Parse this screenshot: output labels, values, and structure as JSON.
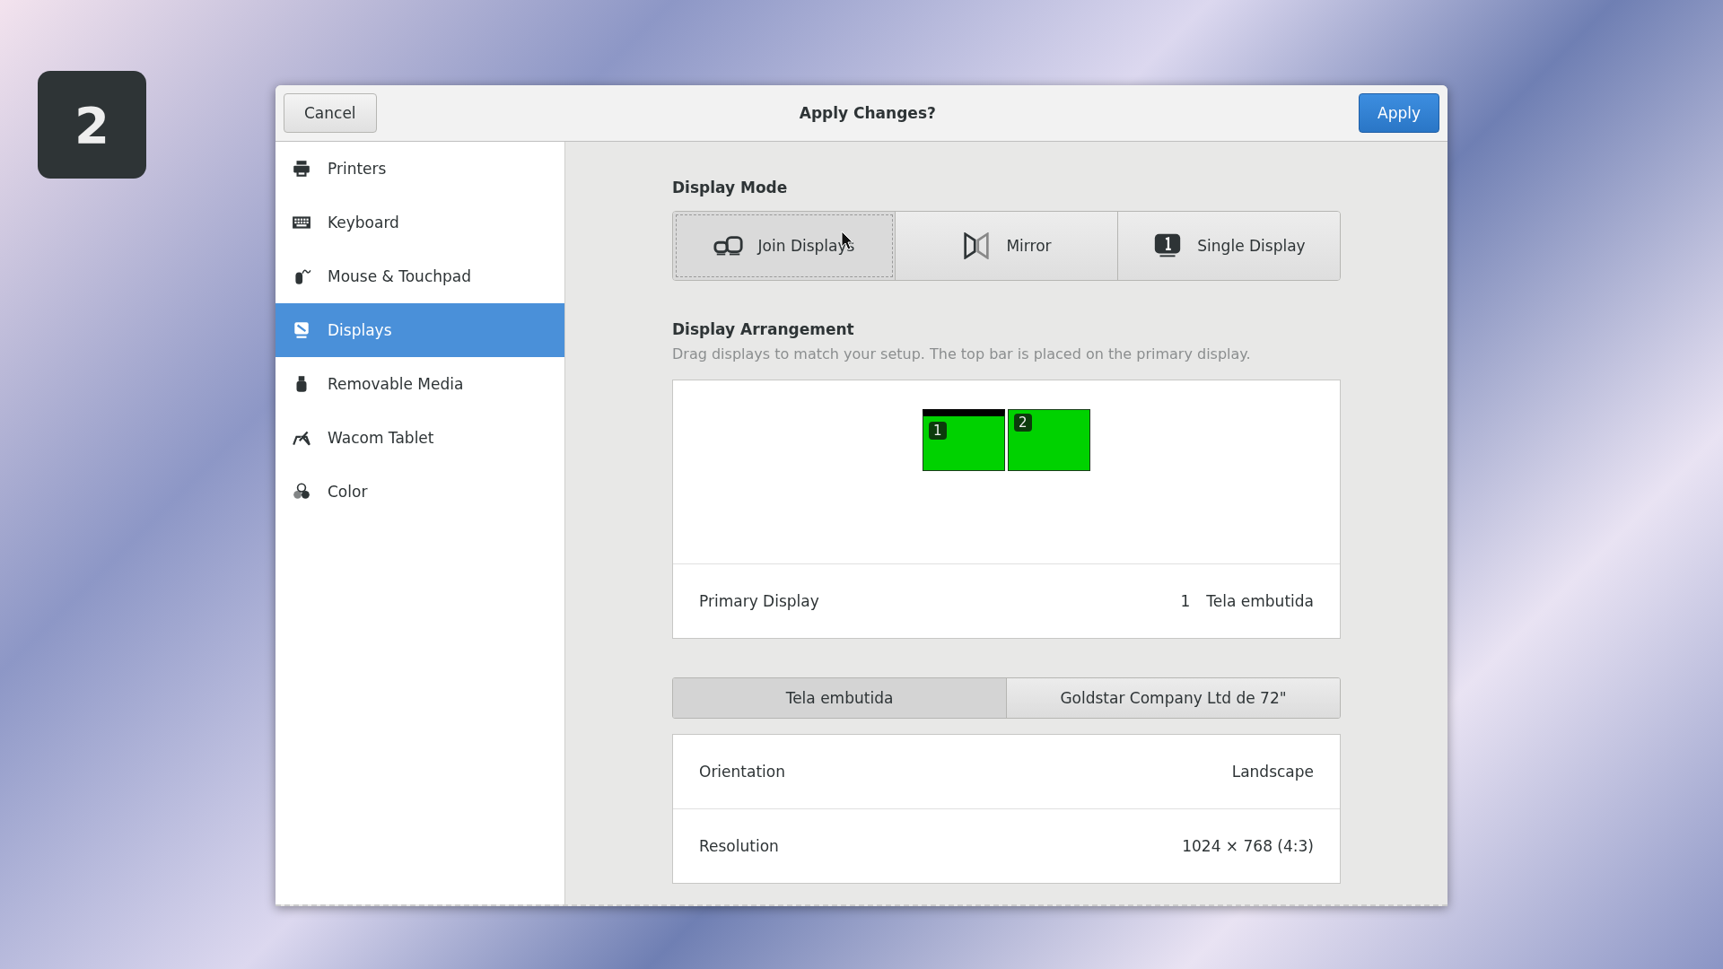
{
  "workspace_badge": "2",
  "header": {
    "cancel": "Cancel",
    "title": "Apply Changes?",
    "apply": "Apply"
  },
  "sidebar": {
    "items": [
      {
        "label": "Printers",
        "kind": "printer",
        "selected": false
      },
      {
        "label": "Keyboard",
        "kind": "keyboard",
        "selected": false
      },
      {
        "label": "Mouse & Touchpad",
        "kind": "mouse",
        "selected": false
      },
      {
        "label": "Displays",
        "kind": "display",
        "selected": true
      },
      {
        "label": "Removable Media",
        "kind": "usb",
        "selected": false
      },
      {
        "label": "Wacom Tablet",
        "kind": "tablet",
        "selected": false
      },
      {
        "label": "Color",
        "kind": "color",
        "selected": false
      }
    ]
  },
  "display_mode": {
    "title": "Display Mode",
    "options": [
      {
        "label": "Join Displays",
        "kind": "join",
        "selected": true
      },
      {
        "label": "Mirror",
        "kind": "mirror",
        "selected": false
      },
      {
        "label": "Single Display",
        "kind": "single",
        "selected": false
      }
    ]
  },
  "arrangement": {
    "title": "Display Arrangement",
    "description": "Drag displays to match your setup. The top bar is placed on the primary display.",
    "monitors": [
      {
        "number": "1",
        "primary": true
      },
      {
        "number": "2",
        "primary": false
      }
    ],
    "primary_display": {
      "label": "Primary Display",
      "number": "1",
      "name": "Tela embutida"
    }
  },
  "display_tabs": [
    {
      "label": "Tela embutida",
      "selected": true
    },
    {
      "label": "Goldstar Company Ltd de 72\"",
      "selected": false
    }
  ],
  "settings": [
    {
      "label": "Orientation",
      "value": "Landscape"
    },
    {
      "label": "Resolution",
      "value": "1024 × 768 (4:3)"
    }
  ]
}
